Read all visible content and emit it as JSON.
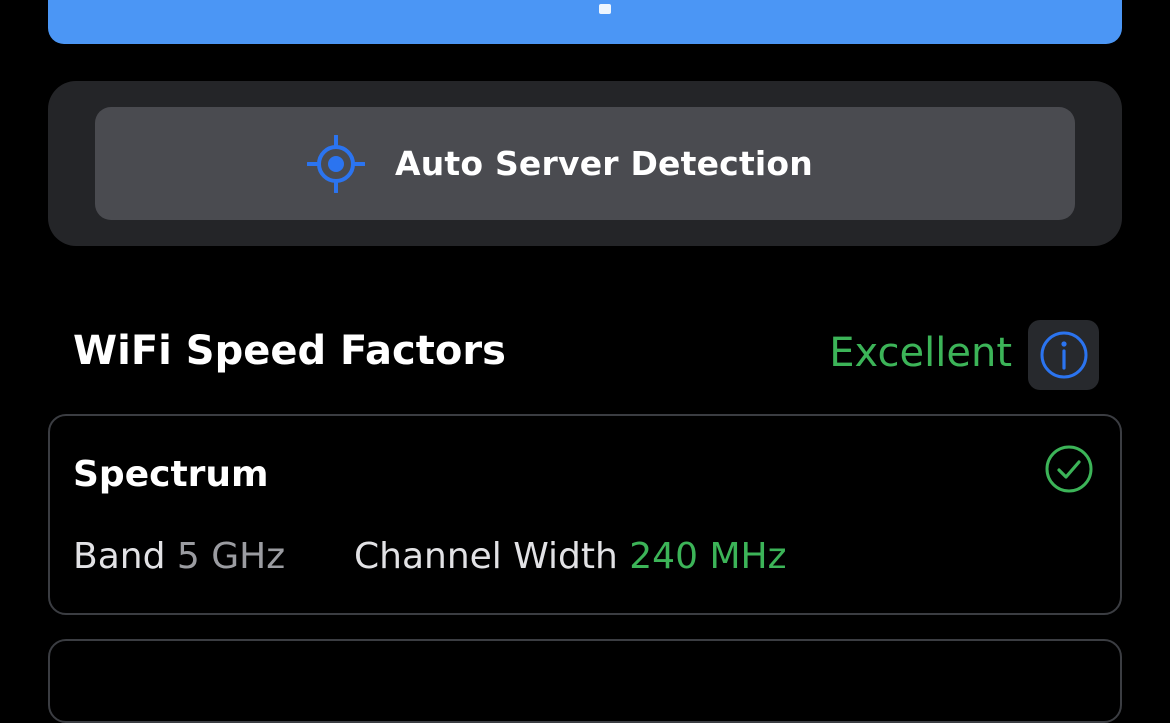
{
  "server_detection": {
    "label": "Auto Server Detection",
    "icon": "crosshair-icon"
  },
  "speed_factors": {
    "title": "WiFi Speed Factors",
    "rating": "Excellent",
    "info_icon": "info-icon"
  },
  "spectrum": {
    "title": "Spectrum",
    "status_icon": "check-circle-icon",
    "band_label": "Band",
    "band_value": "5 GHz",
    "width_label": "Channel Width",
    "width_value": "240 MHz"
  },
  "colors": {
    "accent_blue": "#4b96f5",
    "icon_blue": "#2b74f0",
    "good_green": "#3cb458",
    "card_bg": "#242528",
    "button_bg": "#4a4b50"
  }
}
